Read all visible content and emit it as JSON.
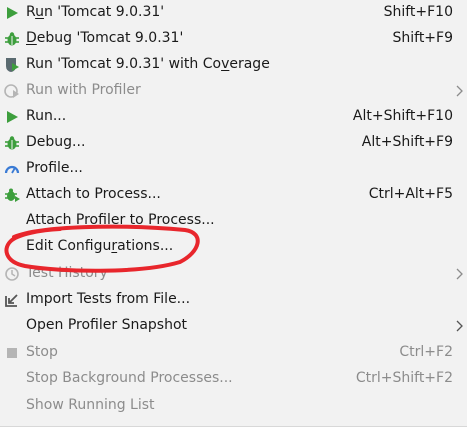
{
  "menu": {
    "items": [
      {
        "label_pre": "R",
        "label_u": "u",
        "label_post": "n 'Tomcat 9.0.31'",
        "shortcut": "Shift+F10",
        "icon": "run-icon",
        "disabled": false
      },
      {
        "label_pre": "",
        "label_u": "D",
        "label_post": "ebug 'Tomcat 9.0.31'",
        "shortcut": "Shift+F9",
        "icon": "debug-icon",
        "disabled": false
      },
      {
        "label_pre": "Run 'Tomcat 9.0.31' with Co",
        "label_u": "v",
        "label_post": "erage",
        "shortcut": "",
        "icon": "coverage-icon",
        "disabled": false
      },
      {
        "label": "Run with Profiler",
        "shortcut": "",
        "icon": "profiler-icon",
        "disabled": true,
        "submenu": true
      },
      {
        "label": "Run...",
        "shortcut": "Alt+Shift+F10",
        "icon": "run-icon",
        "disabled": false
      },
      {
        "label": "Debug...",
        "shortcut": "Alt+Shift+F9",
        "icon": "debug-icon",
        "disabled": false
      },
      {
        "label": "Profile...",
        "shortcut": "",
        "icon": "gauge-icon",
        "disabled": false
      },
      {
        "label": "Attach to Process...",
        "shortcut": "Ctrl+Alt+F5",
        "icon": "attach-bug-icon",
        "disabled": false
      },
      {
        "label": "Attach Profiler to Process...",
        "shortcut": "",
        "icon": "",
        "disabled": false
      },
      {
        "label_pre": "Edit Configu",
        "label_u": "r",
        "label_post": "ations...",
        "shortcut": "",
        "icon": "",
        "disabled": false
      },
      {
        "label": "Test History",
        "shortcut": "",
        "icon": "history-icon",
        "disabled": true,
        "submenu": true
      },
      {
        "label": "Import Tests from File...",
        "shortcut": "",
        "icon": "import-icon",
        "disabled": false
      },
      {
        "label": "Open Profiler Snapshot",
        "shortcut": "",
        "icon": "",
        "disabled": false,
        "submenu": true
      },
      {
        "label": "Stop",
        "shortcut": "Ctrl+F2",
        "icon": "stop-icon",
        "disabled": true
      },
      {
        "label": "Stop Background Processes...",
        "shortcut": "Ctrl+Shift+F2",
        "icon": "",
        "disabled": true
      },
      {
        "label": "Show Running List",
        "shortcut": "",
        "icon": "",
        "disabled": true
      }
    ]
  },
  "colors": {
    "run_green": "#3d9e3d",
    "annotation_red": "#e8262c",
    "disabled_gray": "#8c8c8c"
  }
}
